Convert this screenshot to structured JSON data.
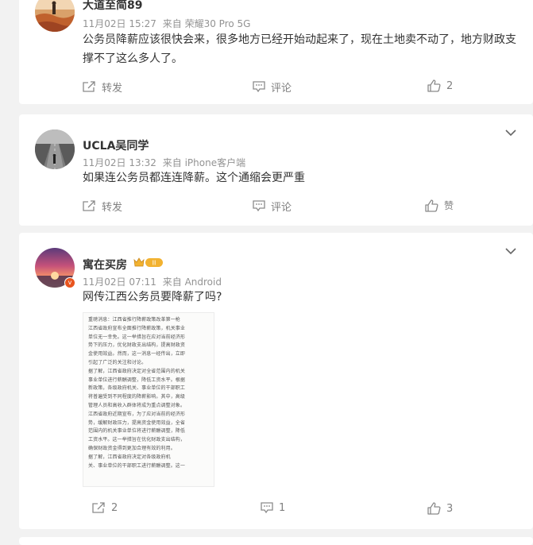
{
  "posts": [
    {
      "user": "大道至简89",
      "date": "11月02日 15:27",
      "source": "来自 荣耀30 Pro 5G",
      "text": "公务员降薪应该很快会来，很多地方已经开始动起来了，现在土地卖不动了，地方财政支撑不了这么多人了。",
      "actions": {
        "repost": "转发",
        "comment": "评论",
        "like": "2"
      }
    },
    {
      "user": "UCLA吴同学",
      "date": "11月02日 13:32",
      "source": "来自 iPhone客户端",
      "text": "如果连公务员都连连降薪。这个通缩会更严重",
      "actions": {
        "repost": "转发",
        "comment": "评论",
        "like": "赞"
      }
    },
    {
      "user": "寓在买房",
      "level_badge": "II",
      "verified_mark": "v",
      "date": "11月02日 07:11",
      "source": "来自 Android",
      "text": "网传江西公务员要降薪了吗?",
      "image_text": [
        "重磅消息：江西省推行降薪政策改革第一枪",
        "江西省政府宣布全面推行降薪政策，机关事业",
        "单位无一幸免。这一举措旨在应对当前经济形",
        "势下的压力，优化财政支出结构，提高财政资",
        "金使用效益。然而，这一消息一经传出，立即",
        "引起了广泛的关注和讨论。",
        "据了解，江西省政府决定对全省范围内的机关",
        "事业单位进行薪酬调整，降低工资水平。根据",
        "新政策，各级政府机关、事业单位的干部职工",
        "将普遍受到不同程度的降薪影响。其中，高级",
        "管理人员和高收入群体将成为重点调整对象。",
        "江西省政府近期宣布，为了应对当前的经济形",
        "势，缓解财政压力，提高资金使用效益，全省",
        "范围内的机关事业单位将进行薪酬调整，降低",
        "工资水平。这一举措旨在优化财政支出结构，",
        "确保财政资金得到更加合理有效的利用。",
        "据了解，江西省政府决定对各级政府机",
        "关、事业单位的干部职工进行薪酬调整。这一"
      ],
      "actions": {
        "repost": "2",
        "comment": "1",
        "like": "3"
      }
    }
  ],
  "colors": {
    "meta": "#939393",
    "action": "#808080",
    "verified": "#e8541e",
    "gold": "#f2b230"
  }
}
